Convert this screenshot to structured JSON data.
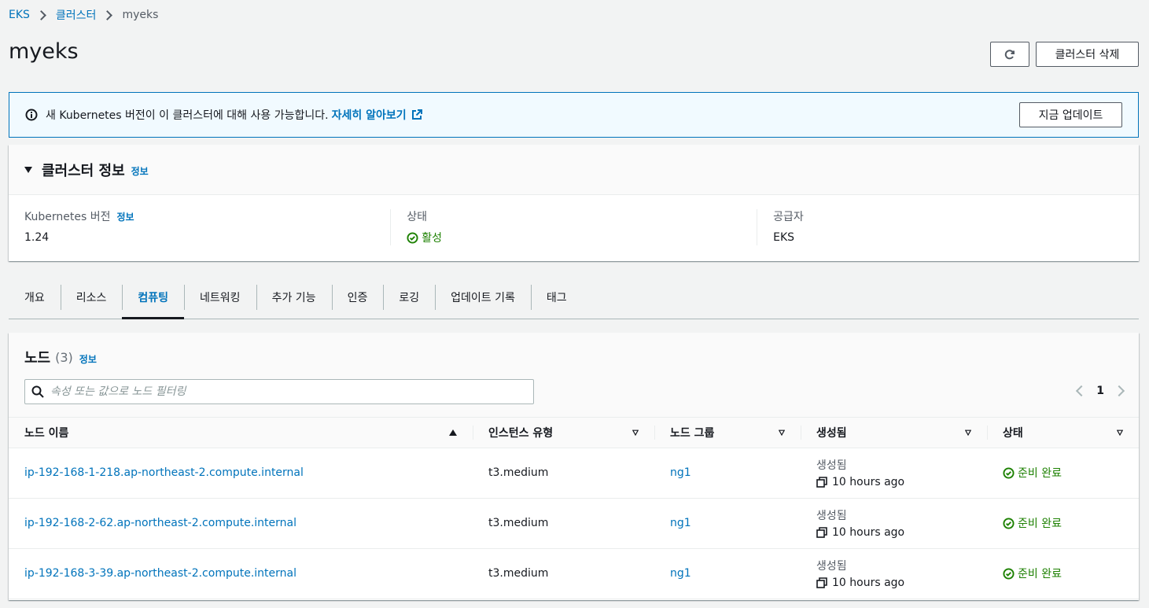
{
  "breadcrumb": {
    "items": [
      "EKS",
      "클러스터"
    ],
    "current": "myeks"
  },
  "page": {
    "title": "myeks",
    "delete_label": "클러스터 삭제"
  },
  "flash": {
    "message": "새 Kubernetes 버전이 이 클러스터에 대해 사용 가능합니다.",
    "learn_more": "자세히 알아보기",
    "update_label": "지금 업데이트"
  },
  "cluster_info": {
    "title": "클러스터 정보",
    "info": "정보",
    "version_label": "Kubernetes 버전",
    "version_info": "정보",
    "version_value": "1.24",
    "status_label": "상태",
    "status_value": "활성",
    "provider_label": "공급자",
    "provider_value": "EKS"
  },
  "tabs": [
    "개요",
    "리소스",
    "컴퓨팅",
    "네트워킹",
    "추가 기능",
    "인증",
    "로깅",
    "업데이트 기록",
    "태그"
  ],
  "active_tab": "컴퓨팅",
  "nodes": {
    "title": "노드",
    "count": "(3)",
    "info": "정보",
    "search_placeholder": "속성 또는 값으로 노드 필터링",
    "page": "1",
    "columns": [
      "노드 이름",
      "인스턴스 유형",
      "노드 그룹",
      "생성됨",
      "상태"
    ],
    "rows": [
      {
        "name": "ip-192-168-1-218.ap-northeast-2.compute.internal",
        "instance_type": "t3.medium",
        "node_group": "ng1",
        "created_label": "생성됨",
        "created": "10 hours ago",
        "status": "준비 완료"
      },
      {
        "name": "ip-192-168-2-62.ap-northeast-2.compute.internal",
        "instance_type": "t3.medium",
        "node_group": "ng1",
        "created_label": "생성됨",
        "created": "10 hours ago",
        "status": "준비 완료"
      },
      {
        "name": "ip-192-168-3-39.ap-northeast-2.compute.internal",
        "instance_type": "t3.medium",
        "node_group": "ng1",
        "created_label": "생성됨",
        "created": "10 hours ago",
        "status": "준비 완료"
      }
    ]
  },
  "colors": {
    "link": "#0073bb",
    "success": "#1d8102",
    "info_bg": "#f1faff"
  }
}
